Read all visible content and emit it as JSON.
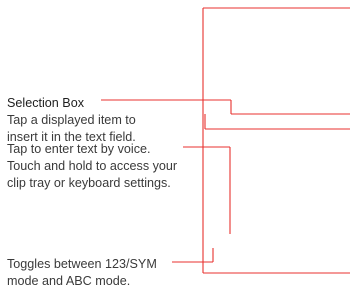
{
  "callouts": {
    "selection_box": {
      "title": "Selection Box",
      "line1": "Tap a displayed item to",
      "line2": "insert it in the text field."
    },
    "voice": {
      "line1": "Tap to enter text by voice.",
      "line2": "Touch and hold to access your",
      "line3": "clip tray or keyboard settings."
    },
    "toggle": {
      "line1": "Toggles between 123/SYM",
      "line2": "mode and ABC mode."
    }
  },
  "colors": {
    "leader_line": "#e8312f",
    "frame": "#9a9a9a",
    "text": "#3a3a3a"
  }
}
